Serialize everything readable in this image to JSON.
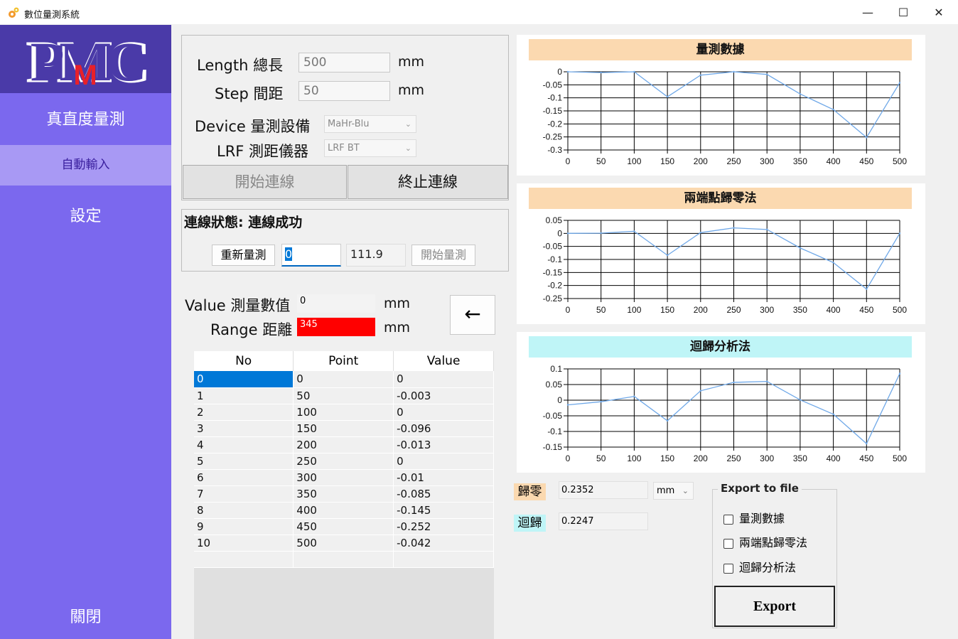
{
  "window": {
    "title": "數位量測系統",
    "controls": [
      "—",
      "☐",
      "✕"
    ]
  },
  "sidebar": {
    "logo": "PMC",
    "items": [
      {
        "label": "真直度量測"
      },
      {
        "label": "自動輸入"
      },
      {
        "label": "設定"
      }
    ],
    "close_label": "關閉"
  },
  "form": {
    "length_label": "Length 總長",
    "length_value": "500",
    "length_unit": "mm",
    "step_label": "Step 間距",
    "step_value": "50",
    "step_unit": "mm",
    "device_label": "Device 量測設備",
    "device_value": "MaHr-Blu",
    "lrf_label": "LRF 測距儀器",
    "lrf_value": "LRF BT",
    "start_conn": "開始連線",
    "stop_conn": "終止連線"
  },
  "status": {
    "text": "連線狀態:  連線成功",
    "remeasure": "重新量測",
    "index_value": "0",
    "reading": "111.9",
    "start_measure": "開始量測"
  },
  "values": {
    "value_label": "Value 測量數值",
    "value": "0",
    "value_unit": "mm",
    "range_label": "Range 距離",
    "range": "345",
    "range_unit": "mm",
    "back_icon": "←"
  },
  "table": {
    "headers": [
      "No",
      "Point",
      "Value"
    ],
    "rows": [
      [
        "0",
        "0",
        "0"
      ],
      [
        "1",
        "50",
        "-0.003"
      ],
      [
        "2",
        "100",
        "0"
      ],
      [
        "3",
        "150",
        "-0.096"
      ],
      [
        "4",
        "200",
        "-0.013"
      ],
      [
        "5",
        "250",
        "0"
      ],
      [
        "6",
        "300",
        "-0.01"
      ],
      [
        "7",
        "350",
        "-0.085"
      ],
      [
        "8",
        "400",
        "-0.145"
      ],
      [
        "9",
        "450",
        "-0.252"
      ],
      [
        "10",
        "500",
        "-0.042"
      ]
    ]
  },
  "results": {
    "zero_label": "歸零",
    "zero_value": "0.2352",
    "unit": "mm",
    "reg_label": "迴歸",
    "reg_value": "0.2247"
  },
  "export": {
    "title": "Export to file",
    "options": [
      "量測數據",
      "兩端點歸零法",
      "迴歸分析法"
    ],
    "button": "Export"
  },
  "colors": {
    "sidebar": "#7b68ee",
    "accent_peach": "#fbd9b0",
    "accent_cyan": "#bff5f7",
    "range_bg": "#ff0000",
    "line": "#6fa8e8"
  },
  "chart_data": [
    {
      "type": "line",
      "title": "量測數據",
      "x": [
        0,
        50,
        100,
        150,
        200,
        250,
        300,
        350,
        400,
        450,
        500
      ],
      "values": [
        0,
        -0.003,
        0,
        -0.096,
        -0.013,
        0,
        -0.01,
        -0.085,
        -0.145,
        -0.252,
        -0.042
      ],
      "ylim": [
        -0.3,
        0
      ],
      "yticks": [
        "0",
        "-0.05",
        "-0.1",
        "-0.15",
        "-0.2",
        "-0.25",
        "-0.3"
      ],
      "xticks": [
        "0",
        "50",
        "100",
        "150",
        "200",
        "250",
        "300",
        "350",
        "400",
        "450",
        "500"
      ],
      "grid": true
    },
    {
      "type": "line",
      "title": "兩端點歸零法",
      "x": [
        0,
        50,
        100,
        150,
        200,
        250,
        300,
        350,
        400,
        450,
        500
      ],
      "values": [
        0,
        0.001,
        0.008,
        -0.084,
        0.003,
        0.021,
        0.015,
        -0.056,
        -0.112,
        -0.214,
        0
      ],
      "ylim": [
        -0.25,
        0.05
      ],
      "yticks": [
        "0.05",
        "0",
        "-0.05",
        "-0.1",
        "-0.15",
        "-0.2",
        "-0.25"
      ],
      "xticks": [
        "0",
        "50",
        "100",
        "150",
        "200",
        "250",
        "300",
        "350",
        "400",
        "450",
        "500"
      ],
      "grid": true
    },
    {
      "type": "line",
      "title": "迴歸分析法",
      "x": [
        0,
        50,
        100,
        150,
        200,
        250,
        300,
        350,
        400,
        450,
        500
      ],
      "values": [
        -0.015,
        -0.005,
        0.012,
        -0.066,
        0.03,
        0.057,
        0.06,
        0.001,
        -0.045,
        -0.139,
        0.085
      ],
      "ylim": [
        -0.15,
        0.1
      ],
      "yticks": [
        "0.1",
        "0.05",
        "0",
        "-0.05",
        "-0.1",
        "-0.15"
      ],
      "xticks": [
        "0",
        "50",
        "100",
        "150",
        "200",
        "250",
        "300",
        "350",
        "400",
        "450",
        "500"
      ],
      "grid": true
    }
  ]
}
